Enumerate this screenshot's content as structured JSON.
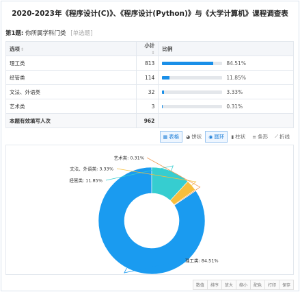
{
  "page_title": "2020-2023年《程序设计(C)》、《程序设计(Python)》与《大学计算机》课程调查表",
  "question": {
    "number": "第1题:",
    "text": "你所属学科门类",
    "type": "[单选题]"
  },
  "table": {
    "headers": {
      "option": "选项",
      "count": "小计",
      "ratio": "比例",
      "sort_icon": "⇕"
    },
    "rows": [
      {
        "label": "理工类",
        "count": "813",
        "percent": "84.51%",
        "fraction": 0.8451
      },
      {
        "label": "经管类",
        "count": "114",
        "percent": "11.85%",
        "fraction": 0.1185
      },
      {
        "label": "文法、外语类",
        "count": "32",
        "percent": "3.33%",
        "fraction": 0.0333
      },
      {
        "label": "艺术类",
        "count": "3",
        "percent": "0.31%",
        "fraction": 0.0031
      }
    ],
    "total": {
      "label": "本题有效填写人次",
      "count": "962"
    }
  },
  "chart_toolbar": [
    {
      "label": "表格",
      "icon": "table-icon",
      "glyph": "▦",
      "active": true
    },
    {
      "label": "饼状",
      "icon": "pie-icon",
      "glyph": "◕",
      "active": false
    },
    {
      "label": "圆环",
      "icon": "donut-icon",
      "glyph": "◉",
      "active": true
    },
    {
      "label": "柱状",
      "icon": "column-icon",
      "glyph": "▮",
      "active": false
    },
    {
      "label": "条形",
      "icon": "bar-icon",
      "glyph": "≡",
      "active": false
    },
    {
      "label": "折线",
      "icon": "line-icon",
      "glyph": "⟋",
      "active": false
    }
  ],
  "bottom_actions": [
    "数值",
    "排序",
    "放大",
    "缩小",
    "配色",
    "打印",
    "保存"
  ],
  "chart_data": {
    "type": "pie",
    "variant": "donut",
    "categories": [
      "理工类",
      "经管类",
      "文法、外语类",
      "艺术类"
    ],
    "values": [
      84.51,
      11.85,
      3.33,
      0.31
    ],
    "labels": [
      "理工类: 84.51%",
      "经管类: 11.85%",
      "文法、外语类: 3.33%",
      "艺术类: 0.31%"
    ],
    "colors": [
      "#1a9bf0",
      "#36cdd0",
      "#f7be3d",
      "#f29c55"
    ],
    "legend": "none"
  },
  "colors": {
    "accent": "#1a8fe8",
    "border": "#e3e8ee"
  }
}
